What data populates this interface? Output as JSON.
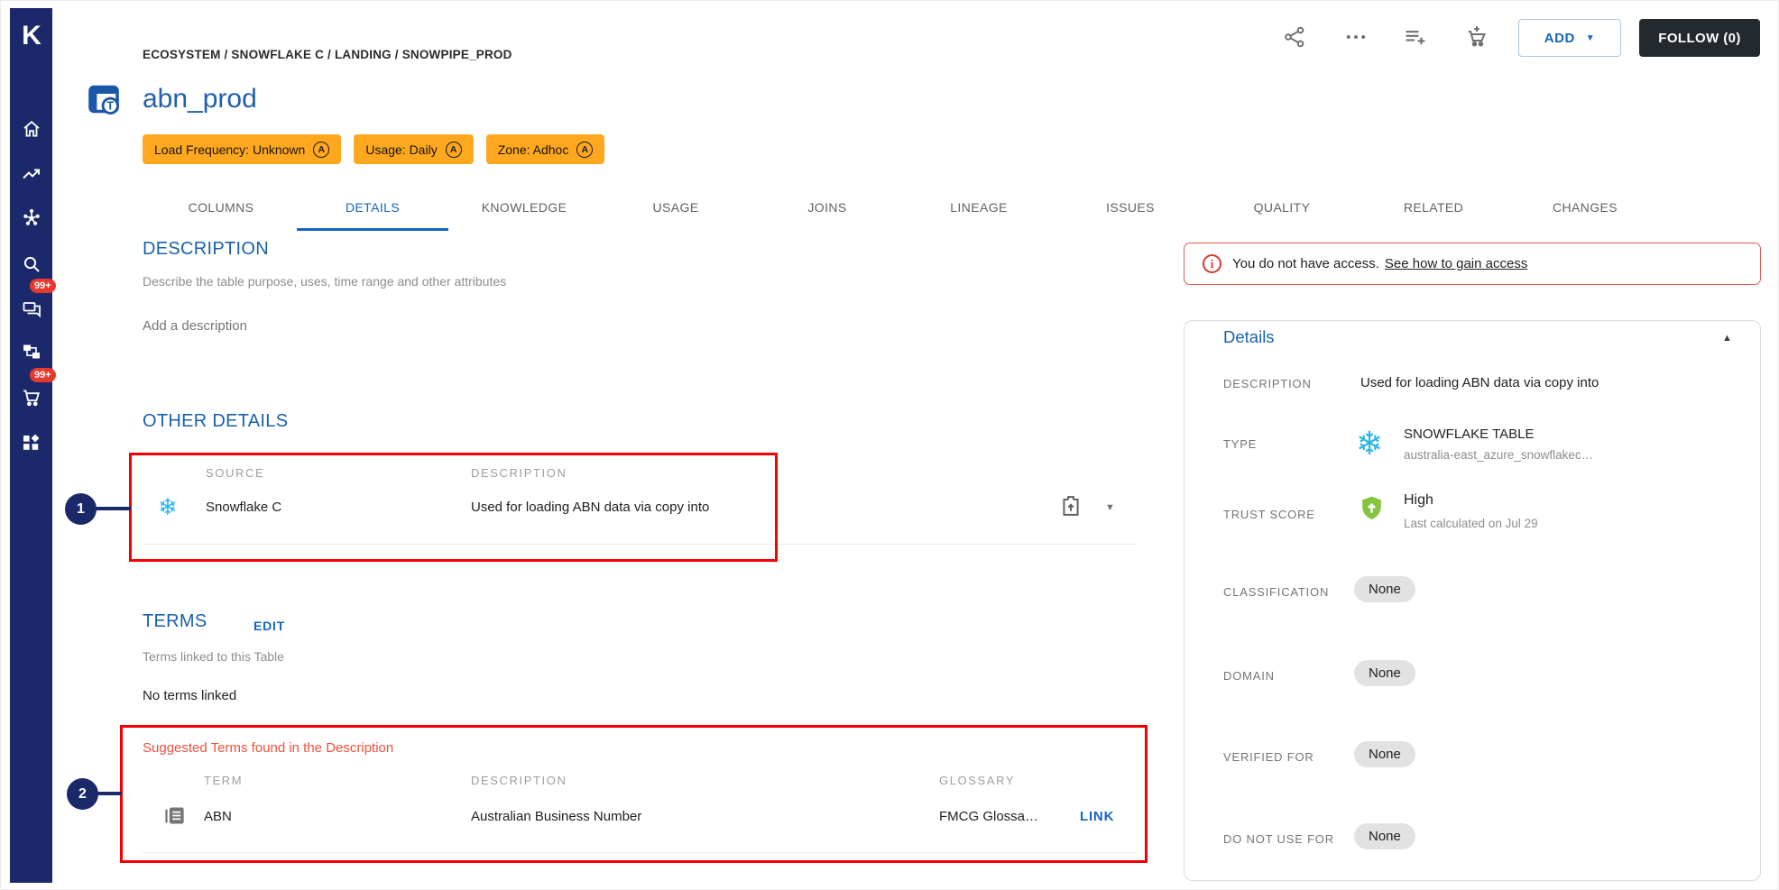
{
  "sidebar": {
    "logo": "K",
    "icons": [
      "home",
      "trending",
      "hub",
      "search",
      "chat",
      "sitemap",
      "cart",
      "apps"
    ],
    "chat_badge": "99+",
    "cart_badge": "99+"
  },
  "topbar": {
    "action_icons": [
      "share",
      "more",
      "playlist-add",
      "add-to-cart"
    ],
    "add_button": "ADD",
    "follow_button": "FOLLOW (0)"
  },
  "header": {
    "breadcrumb": "ECOSYSTEM / SNOWFLAKE C / LANDING / SNOWPIPE_PROD",
    "title": "abn_prod",
    "badges": [
      {
        "label": "Load Frequency: Unknown"
      },
      {
        "label": "Usage: Daily"
      },
      {
        "label": "Zone: Adhoc"
      }
    ]
  },
  "tabs": [
    {
      "label": "COLUMNS"
    },
    {
      "label": "DETAILS",
      "active": true
    },
    {
      "label": "KNOWLEDGE"
    },
    {
      "label": "USAGE"
    },
    {
      "label": "JOINS"
    },
    {
      "label": "LINEAGE"
    },
    {
      "label": "ISSUES"
    },
    {
      "label": "QUALITY"
    },
    {
      "label": "RELATED"
    },
    {
      "label": "CHANGES"
    }
  ],
  "description_section": {
    "heading": "DESCRIPTION",
    "subtitle": "Describe the table purpose, uses, time range and other attributes",
    "placeholder": "Add a description"
  },
  "other_details": {
    "heading": "OTHER DETAILS",
    "col_source": "SOURCE",
    "col_description": "DESCRIPTION",
    "row": {
      "source": "Snowflake C",
      "description": "Used for loading ABN data via copy into"
    }
  },
  "terms": {
    "heading": "TERMS",
    "edit": "EDIT",
    "subtitle": "Terms linked to this Table",
    "empty": "No terms linked"
  },
  "suggested_terms": {
    "title": "Suggested Terms found in the Description",
    "col_term": "TERM",
    "col_description": "DESCRIPTION",
    "col_glossary": "GLOSSARY",
    "row": {
      "term": "ABN",
      "description": "Australian Business Number",
      "glossary": "FMCG Glossa…",
      "link": "LINK"
    }
  },
  "access_banner": {
    "message": "You do not have access.",
    "link": "See how to gain access"
  },
  "details_panel": {
    "title": "Details",
    "description_label": "DESCRIPTION",
    "description_value": "Used for loading ABN data via copy into",
    "type_label": "TYPE",
    "type_value": "SNOWFLAKE TABLE",
    "type_sub": "australia-east_azure_snowflakec…",
    "trust_label": "TRUST SCORE",
    "trust_value": "High",
    "trust_sub": "Last calculated on Jul 29",
    "classification_label": "CLASSIFICATION",
    "classification_value": "None",
    "domain_label": "DOMAIN",
    "domain_value": "None",
    "verified_label": "VERIFIED FOR",
    "verified_value": "None",
    "do_not_use_label": "DO NOT USE FOR",
    "do_not_use_value": "None"
  },
  "annotations": {
    "marker1": "1",
    "marker2": "2"
  },
  "colors": {
    "sidebar_navy": "#1b296b",
    "accent_blue": "#1565c0",
    "heading_blue": "#1961ac",
    "badge_amber": "#ffa81f",
    "annotation_red": "#f50000",
    "suggestion_red": "#f0503c",
    "trust_green": "#86c440",
    "snowflake_blue": "#29b5e8",
    "follow_dark": "#24292e",
    "notification_red": "#e8392e"
  }
}
